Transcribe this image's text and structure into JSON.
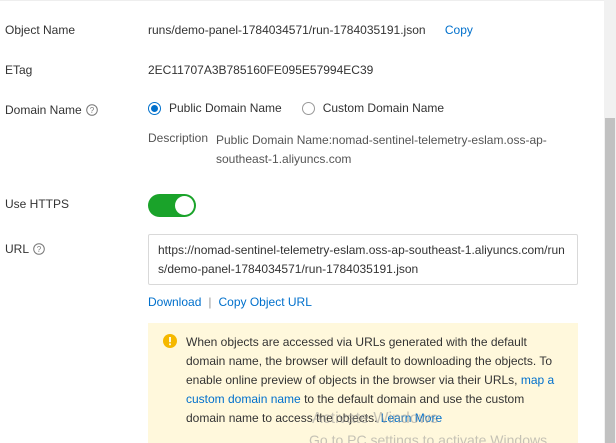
{
  "fields": {
    "object_name": {
      "label": "Object Name",
      "value": "runs/demo-panel-1784034571/run-1784035191.json",
      "copy_label": "Copy"
    },
    "etag": {
      "label": "ETag",
      "value": "2EC11707A3B785160FE095E57994EC39"
    },
    "domain_name": {
      "label": "Domain Name",
      "options": [
        "Public Domain Name",
        "Custom Domain Name"
      ],
      "selected": "Public Domain Name",
      "description_label": "Description",
      "description_text": "Public Domain Name:nomad-sentinel-telemetry-eslam.oss-ap-southeast-1.aliyuncs.com"
    },
    "use_https": {
      "label": "Use HTTPS",
      "enabled": true
    },
    "url": {
      "label": "URL",
      "value": "https://nomad-sentinel-telemetry-eslam.oss-ap-southeast-1.aliyuncs.com/runs/demo-panel-1784034571/run-1784035191.json",
      "download_label": "Download",
      "separator": "|",
      "copy_url_label": "Copy Object URL"
    }
  },
  "notice": {
    "text_before": "When objects are accessed via URLs generated with the default domain name, the browser will default to downloading the objects. To enable online preview of objects in the browser via their URLs, ",
    "link1": "map a custom domain name",
    "text_middle": " to the default domain and use the custom domain name to access the objects. ",
    "link2": "Learn More"
  },
  "watermark": {
    "title": "Activate Windows",
    "subtitle": "Go to PC settings to activate Windows."
  },
  "colors": {
    "accent": "#0070cc",
    "toggle_on": "#1aa32a",
    "notice_bg": "#fff8dc",
    "notice_icon": "#f5b800"
  }
}
